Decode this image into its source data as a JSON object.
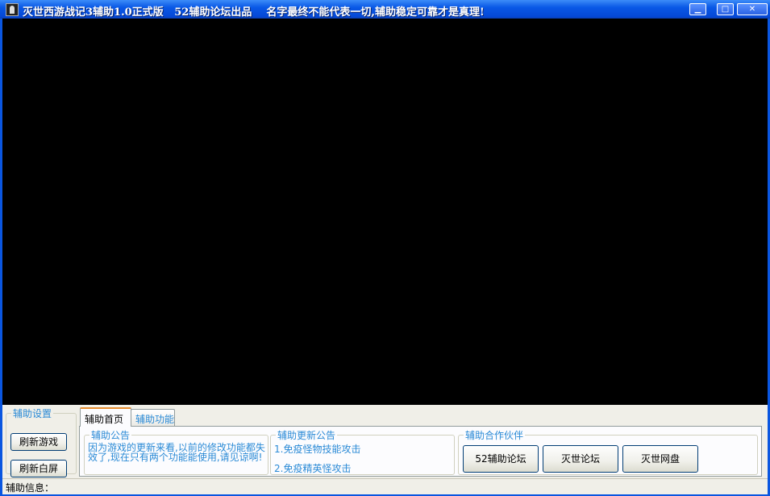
{
  "window": {
    "title": "灭世西游战记3辅助1.0正式版   52辅助论坛出品    名字最终不能代表一切,辅助稳定可靠才是真理!",
    "minimize_label": "▁",
    "maximize_label": "□",
    "close_label": "✕"
  },
  "settings_group": {
    "legend": "辅助设置",
    "refresh_game_label": "刷新游戏",
    "refresh_white_label": "刷新白屏"
  },
  "tabs": [
    {
      "label": "辅助首页",
      "active": true
    },
    {
      "label": "辅助功能",
      "active": false
    }
  ],
  "notice_group": {
    "legend": "辅助公告",
    "text": "因为游戏的更新来看,以前的修改功能都失效了,现在只有两个功能能使用,请见谅啊!"
  },
  "update_group": {
    "legend": "辅助更新公告",
    "items": [
      "1.免疫怪物技能攻击",
      "2.免疫精英怪攻击"
    ]
  },
  "partner_group": {
    "legend": "辅助合作伙伴",
    "buttons": [
      "52辅助论坛",
      "灭世论坛",
      "灭世网盘"
    ]
  },
  "status": {
    "label": "辅助信息："
  }
}
